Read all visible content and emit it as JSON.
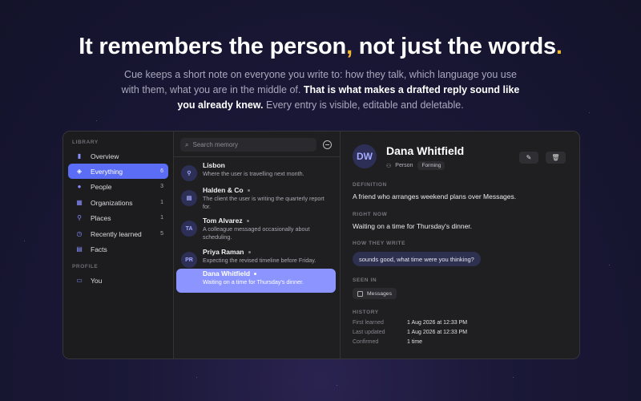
{
  "hero": {
    "title_a": "It remembers the person",
    "comma": ",",
    "title_b": " not just the words",
    "period": ".",
    "sub_a": "Cue keeps a short note on everyone you write to: how they talk, which language you use with them, what you are in the middle of. ",
    "sub_bold": "That is what makes a drafted reply sound like you already knew.",
    "sub_b": " Every entry is visible, editable and deletable.",
    "accent_color": "#f2b632"
  },
  "sidebar": {
    "library_label": "LIBRARY",
    "items": [
      {
        "label": "Overview",
        "count": "",
        "icon": "book-icon"
      },
      {
        "label": "Everything",
        "count": "6",
        "icon": "stack-icon"
      },
      {
        "label": "People",
        "count": "3",
        "icon": "person-icon"
      },
      {
        "label": "Organizations",
        "count": "1",
        "icon": "building-icon"
      },
      {
        "label": "Places",
        "count": "1",
        "icon": "pin-icon"
      },
      {
        "label": "Recently learned",
        "count": "5",
        "icon": "clock-icon"
      },
      {
        "label": "Facts",
        "count": "",
        "icon": "note-icon"
      }
    ],
    "profile_label": "PROFILE",
    "profile_item": {
      "label": "You",
      "icon": "id-card-icon"
    }
  },
  "list": {
    "search_placeholder": "Search memory",
    "rows": [
      {
        "avatar": "⚲",
        "title": "Lisbon",
        "sub": "Where the user is travelling next month."
      },
      {
        "avatar": "▤",
        "title": "Halden & Co",
        "sub": "The client the user is writing the quarterly report for."
      },
      {
        "avatar": "TA",
        "title": "Tom Alvarez",
        "sub": "A colleague messaged occasionally about scheduling."
      },
      {
        "avatar": "PR",
        "title": "Priya Raman",
        "sub": "Expecting the revised timeline before Friday."
      },
      {
        "avatar": "",
        "title": "Dana Whitfield",
        "sub": "Waiting on a time for Thursday's dinner."
      }
    ]
  },
  "detail": {
    "avatar": "DW",
    "name": "Dana Whitfield",
    "kind": "Person",
    "status": "Forming",
    "definition_label": "DEFINITION",
    "definition": "A friend who arranges weekend plans over Messages.",
    "right_now_label": "RIGHT NOW",
    "right_now": "Waiting on a time for Thursday's dinner.",
    "how_label": "HOW THEY WRITE",
    "how_sample": "sounds good, what time were you thinking?",
    "seen_label": "SEEN IN",
    "seen_app": "Messages",
    "history_label": "HISTORY",
    "history": [
      {
        "key": "First learned",
        "value": "1 Aug 2026 at 12:33 PM"
      },
      {
        "key": "Last updated",
        "value": "1 Aug 2026 at 12:33 PM"
      },
      {
        "key": "Confirmed",
        "value": "1 time"
      }
    ]
  }
}
